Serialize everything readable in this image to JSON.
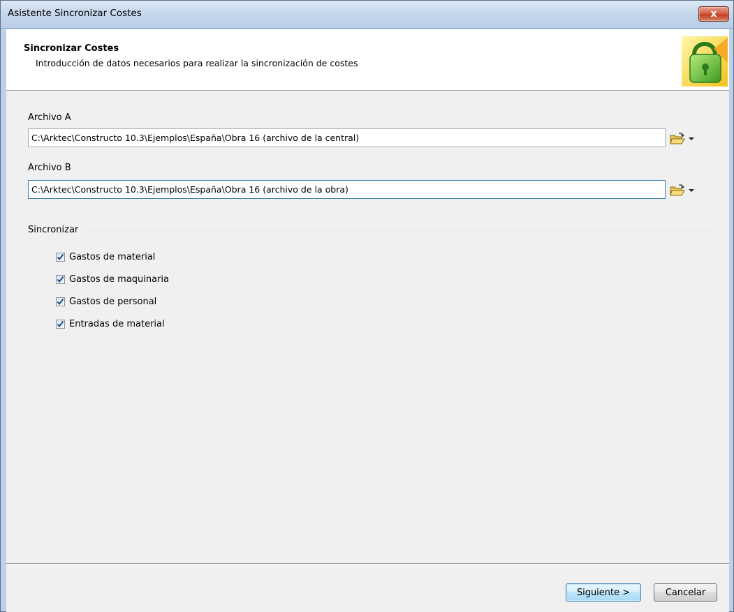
{
  "window": {
    "title": "Asistente Sincronizar Costes",
    "close_label": "x"
  },
  "header": {
    "title": "Sincronizar Costes",
    "subtitle": "Introducción de datos necesarios para realizar la sincronización de costes"
  },
  "file_a": {
    "label": "Archivo A",
    "value": "C:\\Arktec\\Constructo 10.3\\Ejemplos\\España\\Obra 16 (archivo de la central)"
  },
  "file_b": {
    "label": "Archivo B",
    "value": "C:\\Arktec\\Constructo 10.3\\Ejemplos\\España\\Obra 16 (archivo de la obra)"
  },
  "sync": {
    "group_label": "Sincronizar",
    "options": [
      {
        "label": "Gastos de material",
        "checked": true
      },
      {
        "label": "Gastos de maquinaria",
        "checked": true
      },
      {
        "label": "Gastos de personal",
        "checked": true
      },
      {
        "label": "Entradas de material",
        "checked": true
      }
    ]
  },
  "buttons": {
    "next": "Siguiente >",
    "cancel": "Cancelar"
  },
  "icons": {
    "browse": "open-folder-icon",
    "dropdown": "dropdown-arrow-icon",
    "header": "wizard-graphic-icon"
  },
  "colors": {
    "title_bar": "#c4d6ea",
    "close_button": "#c23f25",
    "default_button_border": "#3c7fb1",
    "check_mark": "#1d4a8b"
  }
}
